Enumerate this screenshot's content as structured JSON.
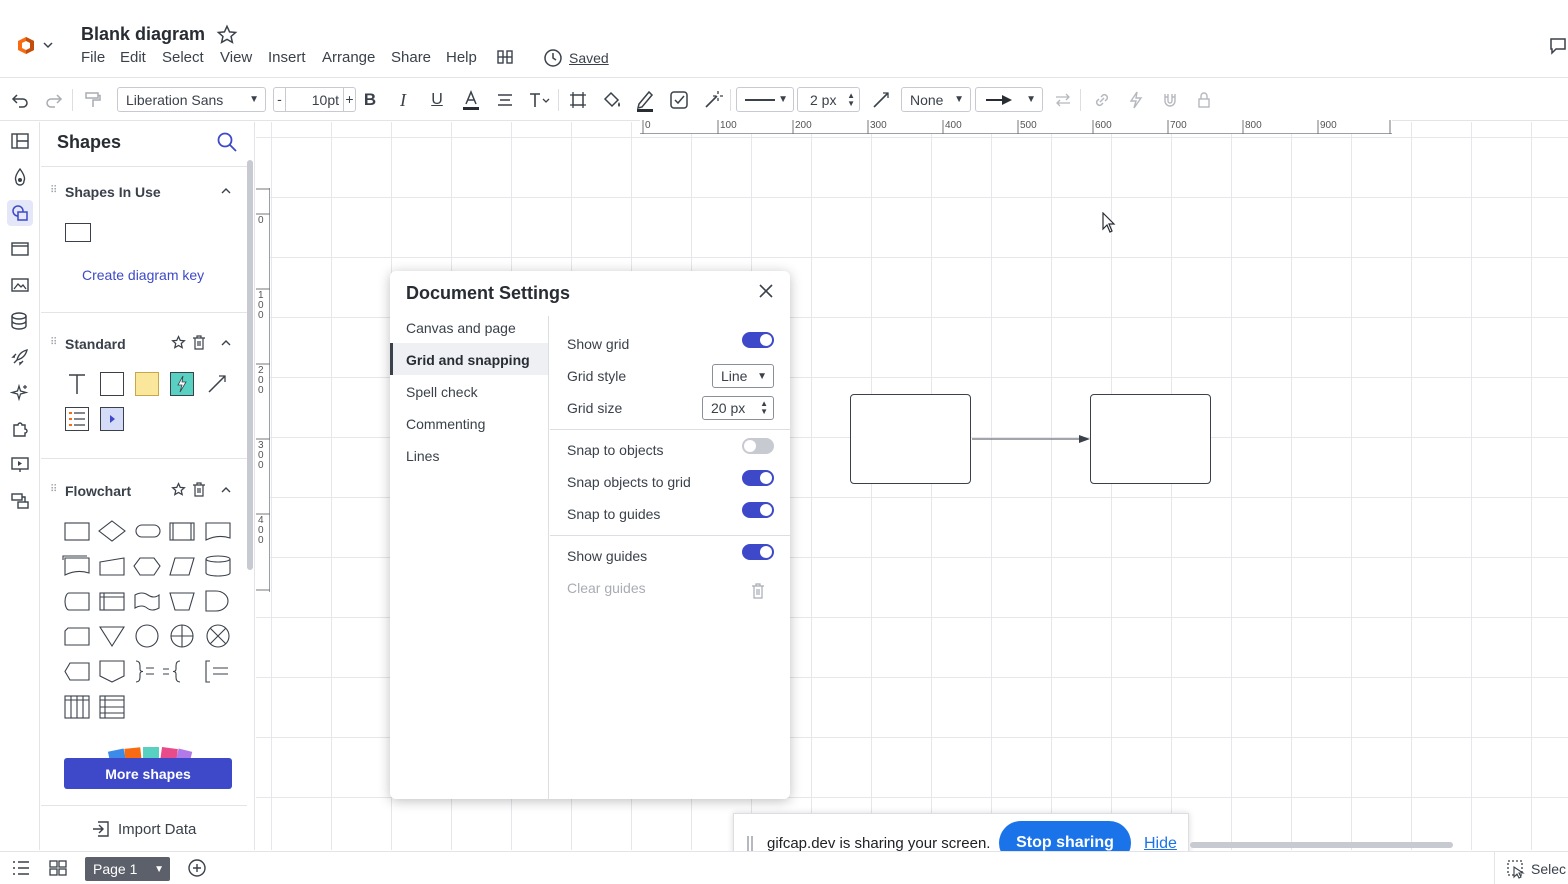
{
  "header": {
    "title": "Blank diagram",
    "saved": "Saved",
    "menu": [
      "File",
      "Edit",
      "Select",
      "View",
      "Insert",
      "Arrange",
      "Share",
      "Help"
    ]
  },
  "toolbar": {
    "font": "Liberation Sans",
    "font_size": "10pt",
    "line_width": "2 px",
    "line_start": "None"
  },
  "shapes_panel": {
    "title": "Shapes",
    "sections": {
      "in_use": "Shapes In Use",
      "create_key": "Create diagram key",
      "standard": "Standard",
      "flowchart": "Flowchart"
    },
    "more_shapes": "More shapes",
    "import_data": "Import Data"
  },
  "ruler": {
    "h": [
      "0",
      "100",
      "200",
      "300",
      "400",
      "500",
      "600",
      "700",
      "800",
      "900"
    ],
    "v": [
      "0",
      "100",
      "200",
      "300",
      "400"
    ]
  },
  "dialog": {
    "title": "Document Settings",
    "nav": [
      "Canvas and page",
      "Grid and snapping",
      "Spell check",
      "Commenting",
      "Lines"
    ],
    "settings": {
      "show_grid": "Show grid",
      "grid_style": "Grid style",
      "grid_style_value": "Line",
      "grid_size": "Grid size",
      "grid_size_value": "20 px",
      "snap_objects": "Snap to objects",
      "snap_grid": "Snap objects to grid",
      "snap_guides": "Snap to guides",
      "show_guides": "Show guides",
      "clear_guides": "Clear guides"
    }
  },
  "sharebar": {
    "message": "gifcap.dev is sharing your screen.",
    "stop": "Stop sharing",
    "hide": "Hide"
  },
  "bottombar": {
    "page": "Page 1",
    "select": "Selec"
  },
  "colors": {
    "accent": "#3d49c8",
    "share_blue": "#1a73e8"
  }
}
